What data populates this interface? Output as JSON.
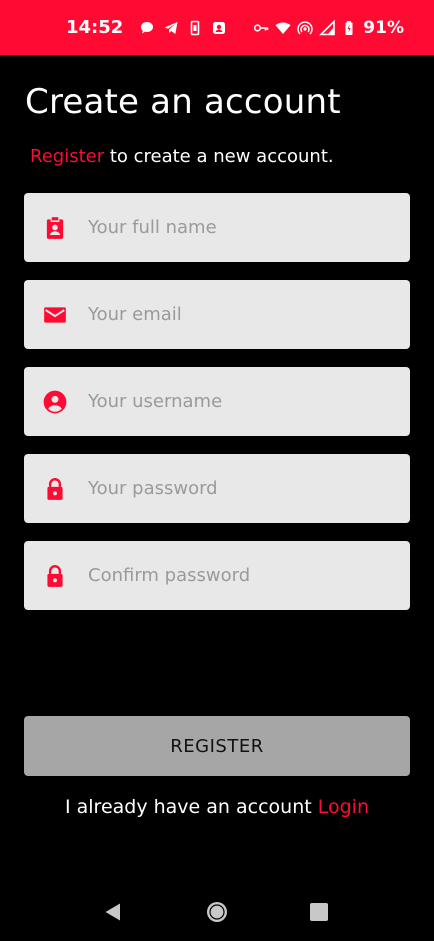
{
  "status_bar": {
    "time": "14:52",
    "battery_percent": "91%",
    "icons_left": [
      "chat-bubble-icon",
      "telegram-icon",
      "sim-icon",
      "contact-icon"
    ],
    "icons_right": [
      "key-icon",
      "wifi-icon",
      "hotspot-icon",
      "signal-icon",
      "battery-icon"
    ]
  },
  "title": "Create an account",
  "subtitle": {
    "accent": "Register",
    "rest": " to create a new account."
  },
  "fields": [
    {
      "icon": "badge-icon",
      "placeholder": "Your full name",
      "value": ""
    },
    {
      "icon": "mail-icon",
      "placeholder": "Your email",
      "value": ""
    },
    {
      "icon": "account-circle-icon",
      "placeholder": "Your username",
      "value": ""
    },
    {
      "icon": "lock-icon",
      "placeholder": "Your password",
      "value": ""
    },
    {
      "icon": "lock-icon",
      "placeholder": "Confirm password",
      "value": ""
    }
  ],
  "register_button": "REGISTER",
  "login_prompt": {
    "text": "I already have an account ",
    "link": "Login"
  },
  "nav": {
    "back": "back-icon",
    "home": "home-icon",
    "recents": "recents-icon"
  },
  "colors": {
    "accent": "#ff0a33",
    "background": "#000000",
    "field": "#e8e8e8",
    "button": "#a6a6a6"
  }
}
